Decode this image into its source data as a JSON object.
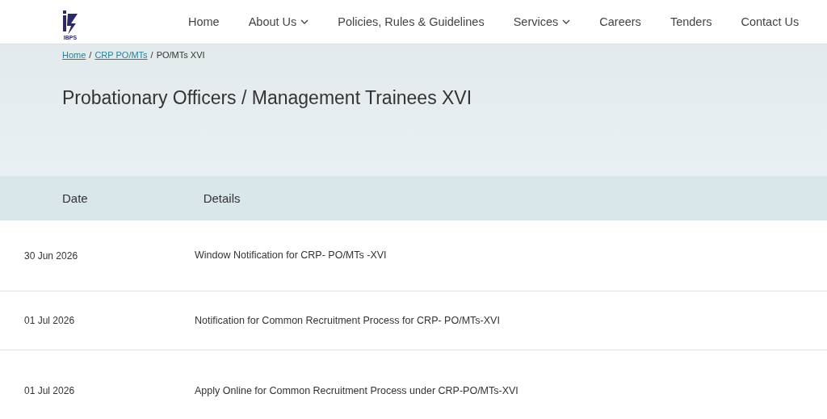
{
  "header": {
    "logo_text": "IBPS",
    "nav": [
      {
        "label": "Home",
        "dropdown": false
      },
      {
        "label": "About Us",
        "dropdown": true
      },
      {
        "label": "Policies, Rules & Guidelines",
        "dropdown": false
      },
      {
        "label": "Services",
        "dropdown": true
      },
      {
        "label": "Careers",
        "dropdown": false
      },
      {
        "label": "Tenders",
        "dropdown": false
      },
      {
        "label": "Contact Us",
        "dropdown": false
      }
    ]
  },
  "breadcrumb_separator": "/",
  "breadcrumb": [
    {
      "label": "Home",
      "link": true
    },
    {
      "label": "CRP PO/MTs",
      "link": true
    },
    {
      "label": "PO/MTs XVI",
      "link": false
    }
  ],
  "page_title": "Probationary Officers / Management Trainees XVI",
  "table": {
    "columns": [
      "Date",
      "Details"
    ],
    "rows": [
      {
        "date": "30 Jun 2026",
        "details": "Window Notification for CRP- PO/MTs -XVI"
      },
      {
        "date": "01 Jul 2026",
        "details": "Notification for Common Recruitment Process for CRP- PO/MTs-XVI"
      },
      {
        "date": "01 Jul 2026",
        "details": "Apply Online for Common Recruitment Process under CRP-PO/MTs-XVI"
      }
    ]
  }
}
